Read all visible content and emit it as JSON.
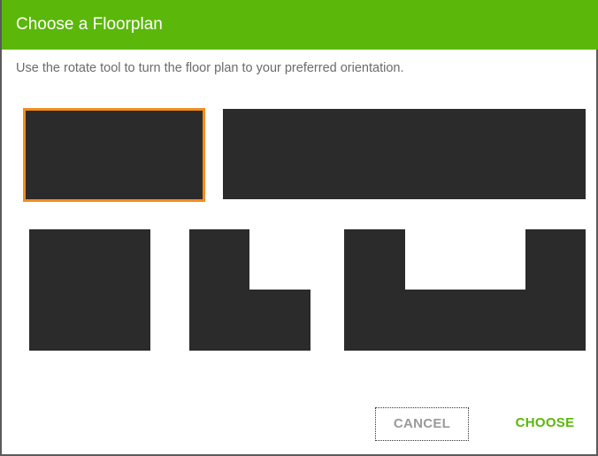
{
  "dialog": {
    "title": "Choose a Floorplan",
    "instruction": "Use the rotate tool to turn the floor plan to your preferred orientation."
  },
  "floorplans": [
    {
      "shape": "rectangle",
      "selected": true
    },
    {
      "shape": "wide-rectangle",
      "selected": false
    },
    {
      "shape": "square",
      "selected": false
    },
    {
      "shape": "l-shape",
      "selected": false
    },
    {
      "shape": "u-shape",
      "selected": false
    }
  ],
  "buttons": {
    "cancel_label": "CANCEL",
    "choose_label": "CHOOSE"
  },
  "colors": {
    "header": "#5bb70a",
    "selection": "#f28c1c",
    "floorplan_fill": "#2b2b2b",
    "choose_text": "#5bb70a",
    "cancel_text": "#9a9a9a"
  }
}
